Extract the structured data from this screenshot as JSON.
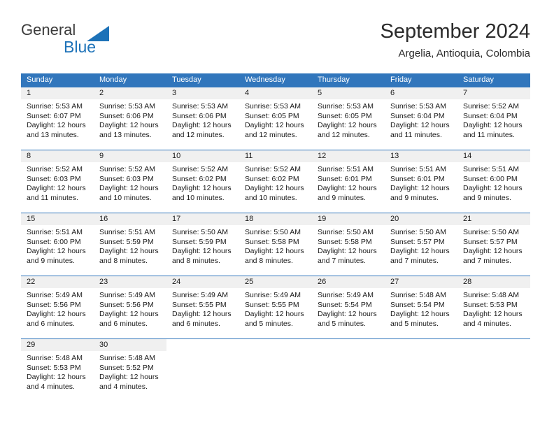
{
  "logo": {
    "general": "General",
    "blue": "Blue",
    "triangle_color": "#1d72b8"
  },
  "header": {
    "title": "September 2024",
    "location": "Argelia, Antioquia, Colombia"
  },
  "theme": {
    "header_blue": "#3176bc",
    "day_band_gray": "#f0f0f0",
    "text": "#1a1a1a"
  },
  "weekdays": [
    "Sunday",
    "Monday",
    "Tuesday",
    "Wednesday",
    "Thursday",
    "Friday",
    "Saturday"
  ],
  "weeks": [
    [
      {
        "day": "1",
        "sunrise": "Sunrise: 5:53 AM",
        "sunset": "Sunset: 6:07 PM",
        "daylight": "Daylight: 12 hours and 13 minutes."
      },
      {
        "day": "2",
        "sunrise": "Sunrise: 5:53 AM",
        "sunset": "Sunset: 6:06 PM",
        "daylight": "Daylight: 12 hours and 13 minutes."
      },
      {
        "day": "3",
        "sunrise": "Sunrise: 5:53 AM",
        "sunset": "Sunset: 6:06 PM",
        "daylight": "Daylight: 12 hours and 12 minutes."
      },
      {
        "day": "4",
        "sunrise": "Sunrise: 5:53 AM",
        "sunset": "Sunset: 6:05 PM",
        "daylight": "Daylight: 12 hours and 12 minutes."
      },
      {
        "day": "5",
        "sunrise": "Sunrise: 5:53 AM",
        "sunset": "Sunset: 6:05 PM",
        "daylight": "Daylight: 12 hours and 12 minutes."
      },
      {
        "day": "6",
        "sunrise": "Sunrise: 5:53 AM",
        "sunset": "Sunset: 6:04 PM",
        "daylight": "Daylight: 12 hours and 11 minutes."
      },
      {
        "day": "7",
        "sunrise": "Sunrise: 5:52 AM",
        "sunset": "Sunset: 6:04 PM",
        "daylight": "Daylight: 12 hours and 11 minutes."
      }
    ],
    [
      {
        "day": "8",
        "sunrise": "Sunrise: 5:52 AM",
        "sunset": "Sunset: 6:03 PM",
        "daylight": "Daylight: 12 hours and 11 minutes."
      },
      {
        "day": "9",
        "sunrise": "Sunrise: 5:52 AM",
        "sunset": "Sunset: 6:03 PM",
        "daylight": "Daylight: 12 hours and 10 minutes."
      },
      {
        "day": "10",
        "sunrise": "Sunrise: 5:52 AM",
        "sunset": "Sunset: 6:02 PM",
        "daylight": "Daylight: 12 hours and 10 minutes."
      },
      {
        "day": "11",
        "sunrise": "Sunrise: 5:52 AM",
        "sunset": "Sunset: 6:02 PM",
        "daylight": "Daylight: 12 hours and 10 minutes."
      },
      {
        "day": "12",
        "sunrise": "Sunrise: 5:51 AM",
        "sunset": "Sunset: 6:01 PM",
        "daylight": "Daylight: 12 hours and 9 minutes."
      },
      {
        "day": "13",
        "sunrise": "Sunrise: 5:51 AM",
        "sunset": "Sunset: 6:01 PM",
        "daylight": "Daylight: 12 hours and 9 minutes."
      },
      {
        "day": "14",
        "sunrise": "Sunrise: 5:51 AM",
        "sunset": "Sunset: 6:00 PM",
        "daylight": "Daylight: 12 hours and 9 minutes."
      }
    ],
    [
      {
        "day": "15",
        "sunrise": "Sunrise: 5:51 AM",
        "sunset": "Sunset: 6:00 PM",
        "daylight": "Daylight: 12 hours and 9 minutes."
      },
      {
        "day": "16",
        "sunrise": "Sunrise: 5:51 AM",
        "sunset": "Sunset: 5:59 PM",
        "daylight": "Daylight: 12 hours and 8 minutes."
      },
      {
        "day": "17",
        "sunrise": "Sunrise: 5:50 AM",
        "sunset": "Sunset: 5:59 PM",
        "daylight": "Daylight: 12 hours and 8 minutes."
      },
      {
        "day": "18",
        "sunrise": "Sunrise: 5:50 AM",
        "sunset": "Sunset: 5:58 PM",
        "daylight": "Daylight: 12 hours and 8 minutes."
      },
      {
        "day": "19",
        "sunrise": "Sunrise: 5:50 AM",
        "sunset": "Sunset: 5:58 PM",
        "daylight": "Daylight: 12 hours and 7 minutes."
      },
      {
        "day": "20",
        "sunrise": "Sunrise: 5:50 AM",
        "sunset": "Sunset: 5:57 PM",
        "daylight": "Daylight: 12 hours and 7 minutes."
      },
      {
        "day": "21",
        "sunrise": "Sunrise: 5:50 AM",
        "sunset": "Sunset: 5:57 PM",
        "daylight": "Daylight: 12 hours and 7 minutes."
      }
    ],
    [
      {
        "day": "22",
        "sunrise": "Sunrise: 5:49 AM",
        "sunset": "Sunset: 5:56 PM",
        "daylight": "Daylight: 12 hours and 6 minutes."
      },
      {
        "day": "23",
        "sunrise": "Sunrise: 5:49 AM",
        "sunset": "Sunset: 5:56 PM",
        "daylight": "Daylight: 12 hours and 6 minutes."
      },
      {
        "day": "24",
        "sunrise": "Sunrise: 5:49 AM",
        "sunset": "Sunset: 5:55 PM",
        "daylight": "Daylight: 12 hours and 6 minutes."
      },
      {
        "day": "25",
        "sunrise": "Sunrise: 5:49 AM",
        "sunset": "Sunset: 5:55 PM",
        "daylight": "Daylight: 12 hours and 5 minutes."
      },
      {
        "day": "26",
        "sunrise": "Sunrise: 5:49 AM",
        "sunset": "Sunset: 5:54 PM",
        "daylight": "Daylight: 12 hours and 5 minutes."
      },
      {
        "day": "27",
        "sunrise": "Sunrise: 5:48 AM",
        "sunset": "Sunset: 5:54 PM",
        "daylight": "Daylight: 12 hours and 5 minutes."
      },
      {
        "day": "28",
        "sunrise": "Sunrise: 5:48 AM",
        "sunset": "Sunset: 5:53 PM",
        "daylight": "Daylight: 12 hours and 4 minutes."
      }
    ],
    [
      {
        "day": "29",
        "sunrise": "Sunrise: 5:48 AM",
        "sunset": "Sunset: 5:53 PM",
        "daylight": "Daylight: 12 hours and 4 minutes."
      },
      {
        "day": "30",
        "sunrise": "Sunrise: 5:48 AM",
        "sunset": "Sunset: 5:52 PM",
        "daylight": "Daylight: 12 hours and 4 minutes."
      },
      {
        "day": "",
        "sunrise": "",
        "sunset": "",
        "daylight": ""
      },
      {
        "day": "",
        "sunrise": "",
        "sunset": "",
        "daylight": ""
      },
      {
        "day": "",
        "sunrise": "",
        "sunset": "",
        "daylight": ""
      },
      {
        "day": "",
        "sunrise": "",
        "sunset": "",
        "daylight": ""
      },
      {
        "day": "",
        "sunrise": "",
        "sunset": "",
        "daylight": ""
      }
    ]
  ]
}
